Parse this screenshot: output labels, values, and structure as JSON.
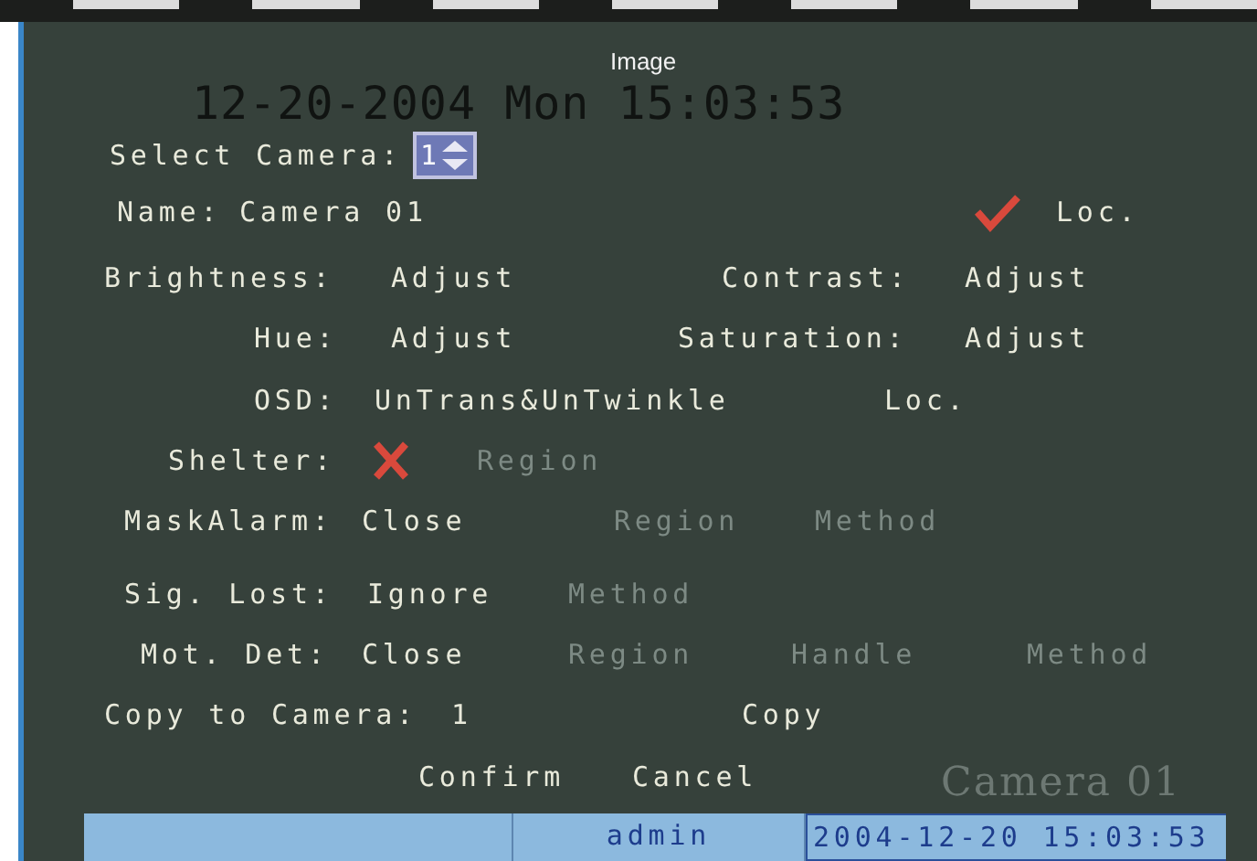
{
  "overlay": {
    "timestamp": "12-20-2004 Mon 15:03:53",
    "camera_name": "Camera 01"
  },
  "title": "Image",
  "rows": [
    {
      "cells": [
        {
          "kind": "label",
          "text": "Select Camera:"
        },
        {
          "kind": "spinner",
          "value": "1"
        }
      ]
    },
    {
      "cells": [
        {
          "kind": "label",
          "text": "Name:"
        },
        {
          "kind": "value",
          "text": "Camera 01"
        },
        {
          "kind": "check",
          "checked": true
        },
        {
          "kind": "action",
          "text": "Loc.",
          "disabled": false
        }
      ]
    },
    {
      "cells": [
        {
          "kind": "label",
          "text": "Brightness:"
        },
        {
          "kind": "action",
          "text": "Adjust",
          "disabled": false
        },
        {
          "kind": "label",
          "text": "Contrast:"
        },
        {
          "kind": "action",
          "text": "Adjust",
          "disabled": false
        }
      ]
    },
    {
      "cells": [
        {
          "kind": "label",
          "text": "Hue:"
        },
        {
          "kind": "action",
          "text": "Adjust",
          "disabled": false
        },
        {
          "kind": "label",
          "text": "Saturation:"
        },
        {
          "kind": "action",
          "text": "Adjust",
          "disabled": false
        }
      ]
    },
    {
      "cells": [
        {
          "kind": "label",
          "text": "OSD:"
        },
        {
          "kind": "value",
          "text": "UnTrans&UnTwinkle"
        },
        {
          "kind": "action",
          "text": "Loc.",
          "disabled": false
        }
      ]
    },
    {
      "cells": [
        {
          "kind": "label",
          "text": "Shelter:"
        },
        {
          "kind": "check",
          "checked": false
        },
        {
          "kind": "action",
          "text": "Region",
          "disabled": true
        }
      ]
    },
    {
      "cells": [
        {
          "kind": "label",
          "text": "MaskAlarm:"
        },
        {
          "kind": "value",
          "text": "Close"
        },
        {
          "kind": "action",
          "text": "Region",
          "disabled": true
        },
        {
          "kind": "action",
          "text": "Method",
          "disabled": true
        }
      ]
    },
    {
      "cells": [
        {
          "kind": "label",
          "text": "Sig. Lost:"
        },
        {
          "kind": "value",
          "text": "Ignore"
        },
        {
          "kind": "action",
          "text": "Method",
          "disabled": true
        }
      ]
    },
    {
      "cells": [
        {
          "kind": "label",
          "text": "Mot. Det:"
        },
        {
          "kind": "value",
          "text": "Close"
        },
        {
          "kind": "action",
          "text": "Region",
          "disabled": true
        },
        {
          "kind": "action",
          "text": "Handle",
          "disabled": true
        },
        {
          "kind": "action",
          "text": "Method",
          "disabled": true
        }
      ]
    },
    {
      "cells": [
        {
          "kind": "label",
          "text": "Copy to Camera:"
        },
        {
          "kind": "value",
          "text": "1"
        },
        {
          "kind": "action",
          "text": "Copy",
          "disabled": false
        }
      ]
    },
    {
      "cells": [
        {
          "kind": "action",
          "text": "Confirm",
          "disabled": false
        },
        {
          "kind": "action",
          "text": "Cancel",
          "disabled": false
        }
      ]
    }
  ],
  "status_bar": {
    "user": "admin",
    "datetime": "2004-12-20 15:03:53"
  }
}
